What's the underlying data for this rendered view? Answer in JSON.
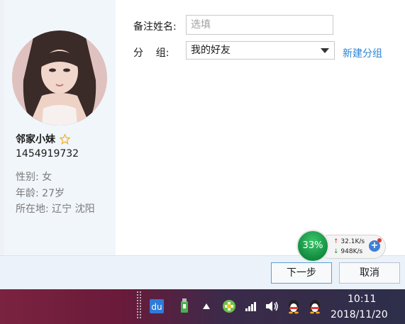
{
  "profile": {
    "nickname": "邻家小妹",
    "qq_number": "1454919732",
    "gender_line": "性别: 女",
    "age_line": "年龄: 27岁",
    "location_line": "所在地: 辽宁  沈阳"
  },
  "form": {
    "remark_label": "备注姓名:",
    "remark_placeholder": "选填",
    "group_label": "分    组:",
    "group_selected": "我的好友",
    "new_group_link": "新建分组"
  },
  "buttons": {
    "next": "下一步",
    "cancel": "取消"
  },
  "speed_widget": {
    "percent": "33%",
    "upload": "32.1K/s",
    "download": "948K/s"
  },
  "taskbar": {
    "tray_icons": [
      "baidu-du-icon",
      "usb-device-icon",
      "show-hidden-icons-arrow",
      "360-security-icon",
      "network-signal-icon",
      "volume-icon",
      "qq-penguin-icon",
      "qq-penguin-icon"
    ],
    "time": "10:11",
    "date": "2018/11/20"
  },
  "colors": {
    "link": "#2b85d6",
    "speed_green": "#1f9e4e",
    "star": "#f2b33d"
  }
}
